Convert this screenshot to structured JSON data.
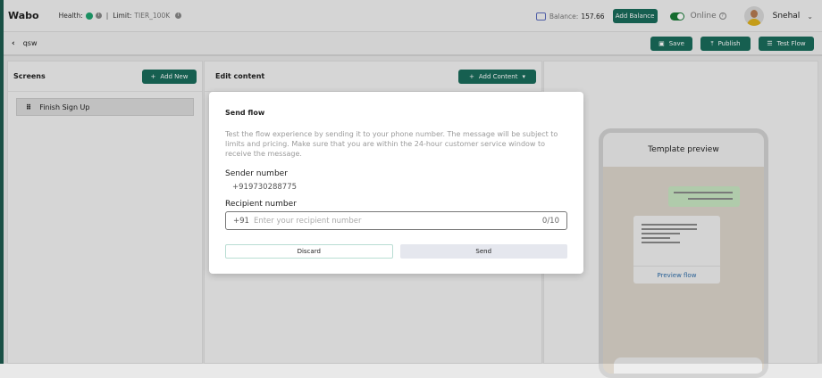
{
  "header": {
    "logo": "Wabo",
    "health_label": "Health:",
    "limit_label": "Limit:",
    "limit_value": "TIER_100K",
    "balance_label": "Balance:",
    "balance_value": "157.66",
    "add_balance": "Add Balance",
    "status": "Online",
    "user": "Snehal"
  },
  "subheader": {
    "back_title": "qsw",
    "save": "Save",
    "publish": "Publish",
    "test_flow": "Test Flow"
  },
  "screens": {
    "title": "Screens",
    "add_new": "Add New",
    "items": [
      "Finish Sign Up"
    ]
  },
  "edit": {
    "title": "Edit content",
    "add_content": "Add Content"
  },
  "preview": {
    "title": "Template preview",
    "link": "Preview flow"
  },
  "modal": {
    "title": "Send flow",
    "description": "Test the flow experience by sending it to your phone number. The message will be subject to limits and pricing. Make sure that you are within the 24-hour customer service window to receive the message.",
    "sender_label": "Sender number",
    "sender_value": "+919730288775",
    "recipient_label": "Recipient number",
    "prefix": "+91",
    "placeholder": "Enter your recipient number",
    "counter": "0/10",
    "discard": "Discard",
    "send": "Send"
  },
  "colors": {
    "brand": "#1a6d5c",
    "online": "#187a36",
    "health": "#1ea36f"
  }
}
